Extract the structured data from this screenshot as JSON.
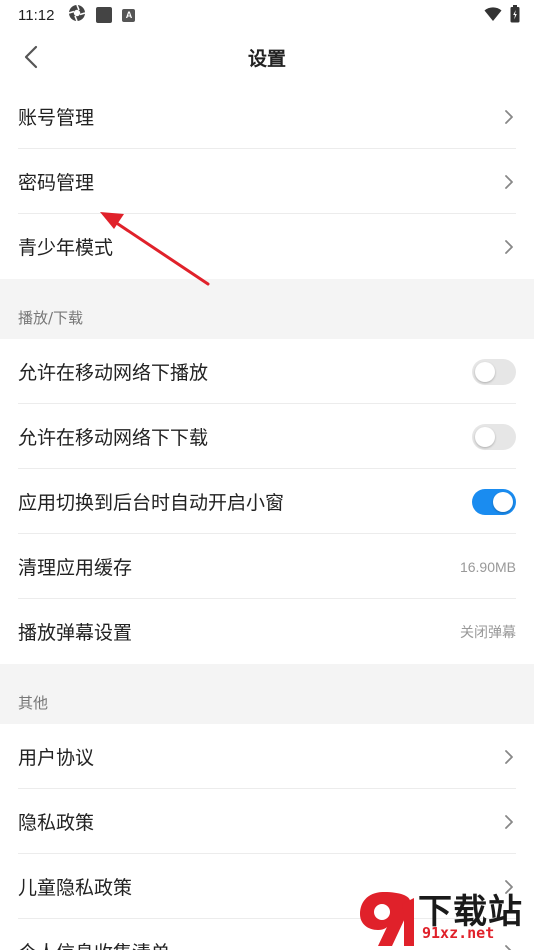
{
  "status_bar": {
    "time": "11:12",
    "icons_left": [
      "aperture-icon",
      "square-icon",
      "a-icon"
    ],
    "icons_right": [
      "wifi-icon",
      "battery-icon"
    ]
  },
  "header": {
    "title": "设置"
  },
  "account_section": {
    "items": [
      {
        "label": "账号管理"
      },
      {
        "label": "密码管理"
      },
      {
        "label": "青少年模式"
      }
    ]
  },
  "playback_section": {
    "heading": "播放/下载",
    "items": [
      {
        "label": "允许在移动网络下播放",
        "toggle": false
      },
      {
        "label": "允许在移动网络下下载",
        "toggle": false
      },
      {
        "label": "应用切换到后台时自动开启小窗",
        "toggle": true
      },
      {
        "label": "清理应用缓存",
        "value": "16.90MB"
      },
      {
        "label": "播放弹幕设置",
        "value": "关闭弹幕"
      }
    ]
  },
  "other_section": {
    "heading": "其他",
    "items": [
      {
        "label": "用户协议"
      },
      {
        "label": "隐私政策"
      },
      {
        "label": "儿童隐私政策"
      },
      {
        "label": "个人信息收集清单"
      }
    ]
  },
  "watermark": {
    "brand": "下载站",
    "url": "91xz.net"
  },
  "colors": {
    "accent": "#1a8cf0",
    "arrow": "#e0212a",
    "section_bg": "#f4f4f4"
  }
}
